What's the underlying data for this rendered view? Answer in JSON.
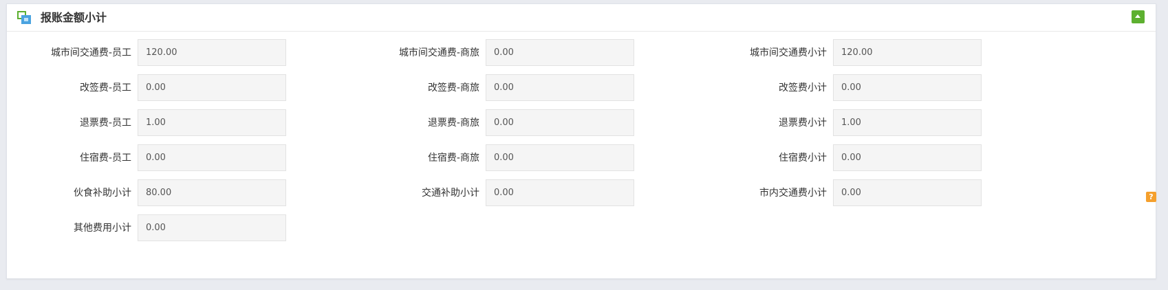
{
  "panel": {
    "title": "报账金额小计",
    "icon": "window-stack-icon",
    "collapse_icon": "collapse-up-icon",
    "accent_color": "#5db030"
  },
  "fields": [
    {
      "label": "城市间交通费-员工",
      "value": "120.00"
    },
    {
      "label": "城市间交通费-商旅",
      "value": "0.00"
    },
    {
      "label": "城市间交通费小计",
      "value": "120.00"
    },
    {
      "label": "改签费-员工",
      "value": "0.00"
    },
    {
      "label": "改签费-商旅",
      "value": "0.00"
    },
    {
      "label": "改签费小计",
      "value": "0.00"
    },
    {
      "label": "退票费-员工",
      "value": "1.00"
    },
    {
      "label": "退票费-商旅",
      "value": "0.00"
    },
    {
      "label": "退票费小计",
      "value": "1.00"
    },
    {
      "label": "住宿费-员工",
      "value": "0.00"
    },
    {
      "label": "住宿费-商旅",
      "value": "0.00"
    },
    {
      "label": "住宿费小计",
      "value": "0.00"
    },
    {
      "label": "伙食补助小计",
      "value": "80.00"
    },
    {
      "label": "交通补助小计",
      "value": "0.00"
    },
    {
      "label": "市内交通费小计",
      "value": "0.00"
    },
    {
      "label": "其他费用小计",
      "value": "0.00"
    }
  ],
  "help": {
    "label": "?",
    "color": "#f5a02d"
  }
}
